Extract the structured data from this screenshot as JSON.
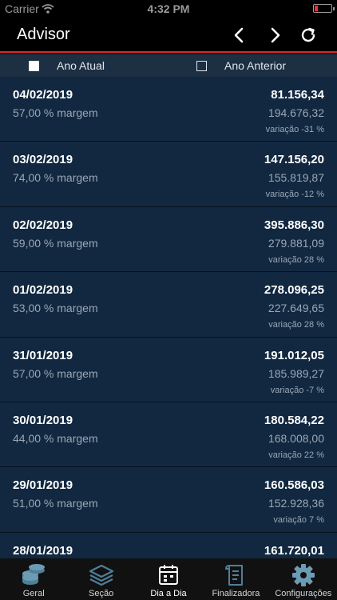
{
  "status_bar": {
    "carrier": "Carrier",
    "time": "4:32 PM"
  },
  "header": {
    "title": "Advisor"
  },
  "filters": {
    "current_year": "Ano Atual",
    "previous_year": "Ano Anterior"
  },
  "rows": [
    {
      "date": "04/02/2019",
      "margin": "57,00 % margem",
      "current": "81.156,34",
      "previous": "194.676,32",
      "variation": "variação -31 %"
    },
    {
      "date": "03/02/2019",
      "margin": "74,00 % margem",
      "current": "147.156,20",
      "previous": "155.819,87",
      "variation": "variação -12 %"
    },
    {
      "date": "02/02/2019",
      "margin": "59,00 % margem",
      "current": "395.886,30",
      "previous": "279.881,09",
      "variation": "variação 28 %"
    },
    {
      "date": "01/02/2019",
      "margin": "53,00 % margem",
      "current": "278.096,25",
      "previous": "227.649,65",
      "variation": "variação 28 %"
    },
    {
      "date": "31/01/2019",
      "margin": "57,00 % margem",
      "current": "191.012,05",
      "previous": "185.989,27",
      "variation": "variação -7 %"
    },
    {
      "date": "30/01/2019",
      "margin": "44,00 % margem",
      "current": "180.584,22",
      "previous": "168.008,00",
      "variation": "variação 22 %"
    },
    {
      "date": "29/01/2019",
      "margin": "51,00 % margem",
      "current": "160.586,03",
      "previous": "152.928,36",
      "variation": "variação 7 %"
    },
    {
      "date": "28/01/2019",
      "margin": "",
      "current": "161.720,01",
      "previous": "",
      "variation": ""
    }
  ],
  "tabs": [
    {
      "label": "Geral",
      "icon": "coins-icon"
    },
    {
      "label": "Seção",
      "icon": "layers-icon"
    },
    {
      "label": "Dia a Dia",
      "icon": "calendar-icon"
    },
    {
      "label": "Finalizadora",
      "icon": "receipt-icon"
    },
    {
      "label": "Configurações",
      "icon": "gear-icon"
    }
  ],
  "colors": {
    "accent": "#e0262a",
    "row_background": "#112840",
    "filter_background": "#1d2f42",
    "tab_icon": "#4f7f99"
  }
}
